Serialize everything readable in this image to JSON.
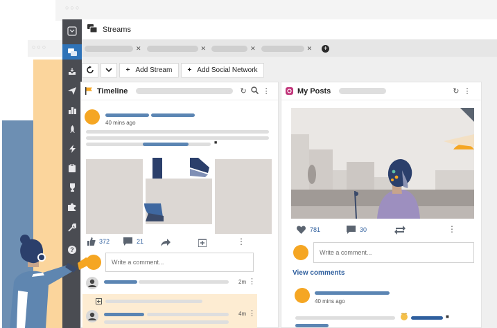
{
  "app": {
    "title": "Streams",
    "colors": {
      "sidebar": "#4a4c52",
      "active": "#2f73b8",
      "accent": "#f5a623",
      "link": "#2f5f9e"
    }
  },
  "sidebar": {
    "items": [
      {
        "icon": "streams-icon",
        "glyph": "▣"
      },
      {
        "icon": "inbox-icon",
        "glyph": "⇩"
      },
      {
        "icon": "send-icon",
        "glyph": "➤"
      },
      {
        "icon": "analytics-icon",
        "glyph": "▮"
      },
      {
        "icon": "rocket-icon",
        "glyph": "✦"
      },
      {
        "icon": "lightning-icon",
        "glyph": "⚡"
      },
      {
        "icon": "clipboard-icon",
        "glyph": "▤"
      },
      {
        "icon": "trophy-icon",
        "glyph": "♛"
      },
      {
        "icon": "puzzle-icon",
        "glyph": "✚"
      },
      {
        "icon": "wrench-icon",
        "glyph": "✎"
      },
      {
        "icon": "help-icon",
        "glyph": "?"
      }
    ]
  },
  "toolbar": {
    "add_stream_label": "Add Stream",
    "add_network_label": "Add Social Network",
    "plus": "+"
  },
  "timeline": {
    "title": "Timeline",
    "post_time": "40 mins ago",
    "likes": "372",
    "comments": "21",
    "comment_placeholder": "Write a comment...",
    "reply1_time": "2m",
    "reply2_time": "4m"
  },
  "myposts": {
    "title": "My Posts",
    "likes": "781",
    "comments": "30",
    "comment_placeholder": "Write a comment...",
    "view_comments": "View comments",
    "post_time": "40 mins ago"
  }
}
